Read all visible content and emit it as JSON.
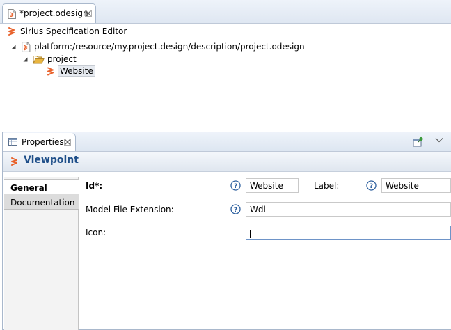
{
  "editor": {
    "tab": {
      "title": "*project.odesign"
    },
    "header_title": "Sirius Specification Editor",
    "tree": [
      {
        "label": "platform:/resource/my.project.design/description/project.odesign"
      },
      {
        "label": "project"
      },
      {
        "label": "Website",
        "selected": true
      }
    ]
  },
  "properties": {
    "tab_title": "Properties",
    "view_title": "Viewpoint",
    "side_tabs": [
      {
        "label": "General",
        "active": true
      },
      {
        "label": "Documentation",
        "active": false
      }
    ],
    "fields": {
      "id": {
        "label": "Id*:",
        "value": "Website"
      },
      "label": {
        "label": "Label:",
        "value": "Website"
      },
      "model_file_extension": {
        "label": "Model File Extension:",
        "value": "Wdl"
      },
      "icon": {
        "label": "Icon:",
        "value": ""
      }
    }
  },
  "colors": {
    "sirius_accent": "#e8622c",
    "view_title": "#1f4f89",
    "help_blue": "#2c5f9e",
    "folder_yellow": "#e9b53f"
  },
  "icons": [
    "file-odesign-icon",
    "close-icon",
    "sirius-icon",
    "tree-expanded-icon",
    "folder-open-icon",
    "properties-icon",
    "pin-icon",
    "view-menu-icon",
    "help-icon"
  ]
}
